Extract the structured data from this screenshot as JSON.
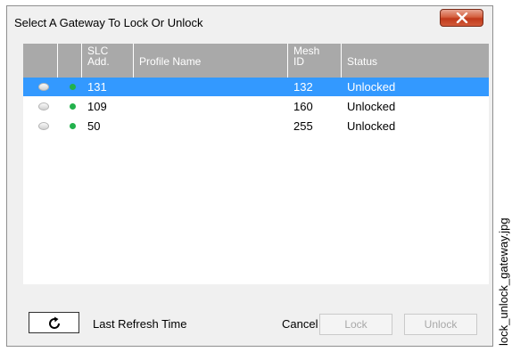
{
  "dialog": {
    "title": "Select A Gateway To Lock Or Unlock",
    "close_icon": "close-x-icon"
  },
  "grid": {
    "columns": [
      "",
      "",
      "SLC\nAdd.",
      "Profile Name",
      "Mesh\nID",
      "Status"
    ],
    "rows": [
      {
        "slc": "131",
        "profile": "",
        "mesh_id": "132",
        "status": "Unlocked",
        "selected": true,
        "online": true
      },
      {
        "slc": "109",
        "profile": "",
        "mesh_id": "160",
        "status": "Unlocked",
        "selected": false,
        "online": true
      },
      {
        "slc": "50",
        "profile": "",
        "mesh_id": "255",
        "status": "Unlocked",
        "selected": false,
        "online": true
      }
    ]
  },
  "footer": {
    "refresh_icon": "refresh-icon",
    "last_refresh_label": "Last Refresh Time",
    "cancel_label": "Cancel",
    "lock_label": "Lock",
    "unlock_label": "Unlock"
  },
  "watermark": "lock_unlock_gateway.jpg",
  "colors": {
    "selection": "#3399ff",
    "header": "#a9a9a9",
    "online_dot": "#22b14c",
    "close_button": "#c0391b"
  }
}
